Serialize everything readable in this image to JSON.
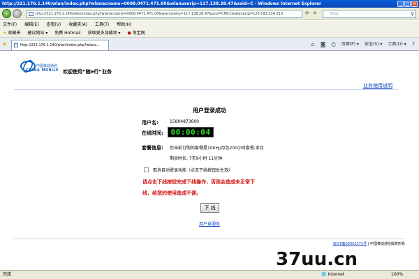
{
  "window": {
    "title": "http://221.176.1.140/wlan/index.php?wlanacname=0008.0471.471.00&wlanuserip=117.138.28.47&ssid=C - Windows Internet Explorer"
  },
  "address_bar": {
    "url": "http://221.176.1.140/wlan/index.php?wlanacname=0008.0471.471.00&wlanuserip=117.138.28.47&ssid=CMCC&wlanacip=120.193.234.210",
    "search_placeholder": "Bing"
  },
  "menu": [
    "文件(F)",
    "编辑(E)",
    "查看(V)",
    "收藏夹(A)",
    "工具(T)",
    "帮助(H)"
  ],
  "favorites_bar": {
    "favorites_label": "收藏夹",
    "suggested_sites": "建议网站 ▾",
    "free_hotmail": "免费 Hotmail",
    "get_more": "获取更多加载项 ▾",
    "taobao": "淘宝网"
  },
  "tab": {
    "title": "http://221.176.1.140/wlan/index.php?wlana..."
  },
  "toolbar": {
    "page_label": "页面(P) ▾",
    "safety_label": "安全(S) ▾",
    "tools_label": "工具(O) ▾",
    "help_icon": "?"
  },
  "page": {
    "logo_cn": "中国移动通信",
    "logo_en": "CHINA MOBILE",
    "welcome": "欢迎使用“随e行”业务",
    "help_link": "业务使用说明",
    "heading": "用户登录成功",
    "username_label": "用户名:",
    "username_value": "15804873600",
    "online_time_label": "在线时间:",
    "online_time_value": "00:00:04",
    "package_label": "套餐信息:",
    "package_line1": "您当前订购的套餐是100元/月包200小时套餐,本月",
    "package_line2": "剩余时长: 7天9小时 11分钟",
    "auto_login_text": "取消自动登录功能（点击下线按钮后生效）",
    "warning_line1": "请点击下线按钮完成下线操作，否则会造成未正常下",
    "warning_line2": "线，给您的使用造成不便。",
    "logout_button": "下 线",
    "self_service_link": "用户自服务",
    "footer_link": "京ICP备05002571号",
    "footer_text": "中国移动通信版权所有"
  },
  "watermark": "37uu.cn",
  "status_bar": {
    "status": "完成",
    "zone": "Internet",
    "zoom": "100%"
  }
}
